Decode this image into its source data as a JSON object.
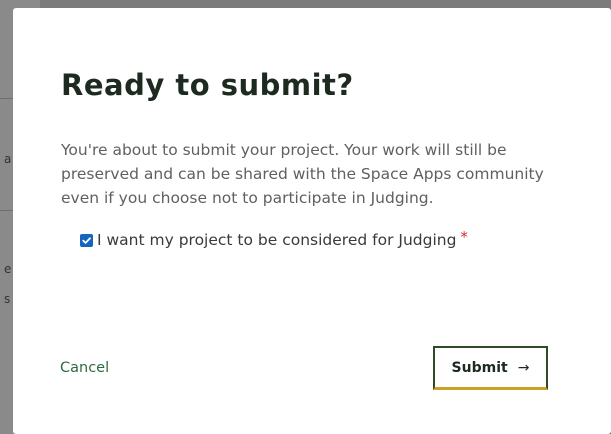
{
  "backdrop": {
    "char_a": "a",
    "char_e": "e",
    "char_s": "s"
  },
  "modal": {
    "title": "Ready to submit?",
    "body_text": "You're about to submit your project. Your work will still be preserved and can be shared with the Space Apps community even if you choose not to participate in Judging.",
    "checkbox": {
      "label": "I want my project to be considered for Judging",
      "checked": true,
      "required_mark": "*"
    },
    "cancel_label": "Cancel",
    "submit_label": "Submit",
    "submit_arrow": "→"
  },
  "colors": {
    "accent_green": "#2e6b3f",
    "accent_gold": "#c9a227",
    "checkbox_blue": "#1565c0",
    "required_red": "#d32f2f"
  }
}
